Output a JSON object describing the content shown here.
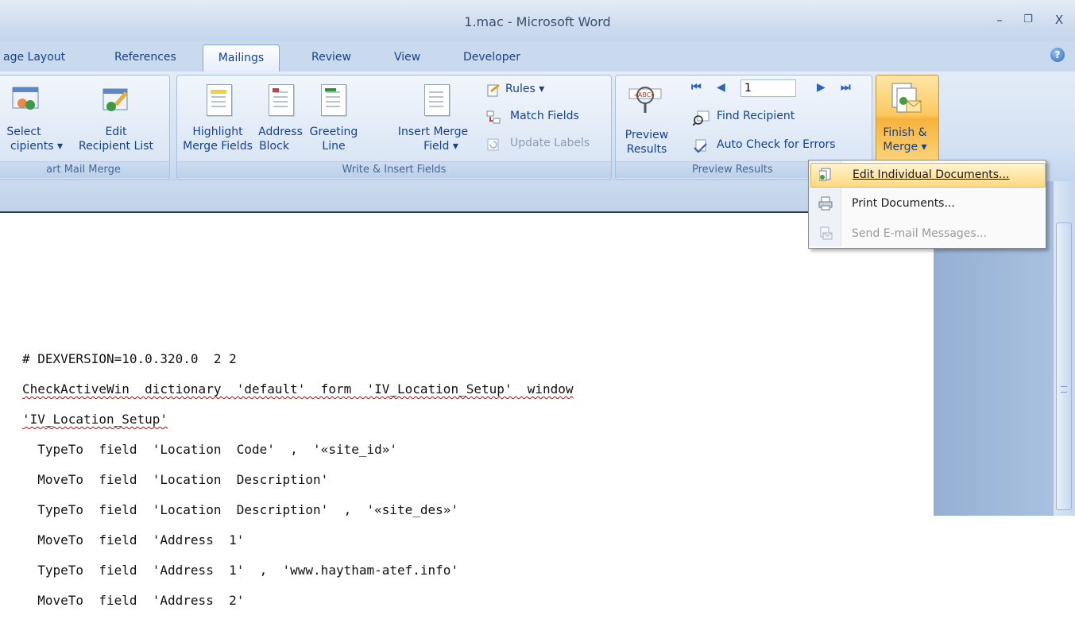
{
  "window": {
    "title": "1.mac - Microsoft Word",
    "minimize": "–",
    "restore": "❐",
    "close": "X"
  },
  "tabs": [
    {
      "label": "age Layout"
    },
    {
      "label": "References"
    },
    {
      "label": "Mailings"
    },
    {
      "label": "Review"
    },
    {
      "label": "View"
    },
    {
      "label": "Developer"
    }
  ],
  "active_tab": "Mailings",
  "help": "?",
  "ribbon": {
    "start": {
      "label": "art Mail Merge",
      "select_l1": "Select",
      "select_l2": "cipients ▾",
      "edit_l1": "Edit",
      "edit_l2": "Recipient List"
    },
    "write": {
      "label": "Write & Insert Fields",
      "highlight_l1": "Highlight",
      "highlight_l2": "Merge Fields",
      "address_l1": "Address",
      "address_l2": "Block",
      "greeting_l1": "Greeting",
      "greeting_l2": "Line",
      "insert_l1": "Insert Merge",
      "insert_l2": "Field ▾",
      "rules": "Rules ▾",
      "match": "Match Fields",
      "update": "Update Labels"
    },
    "preview": {
      "label": "Preview Results",
      "preview_l1": "Preview",
      "preview_l2": "Results",
      "record": "1",
      "find": "Find Recipient",
      "auto": "Auto Check for Errors"
    },
    "finish": {
      "l1": "Finish &",
      "l2": "Merge ▾"
    }
  },
  "menu": {
    "items": [
      {
        "label": "Edit Individual Documents...",
        "enabled": true,
        "highlighted": true
      },
      {
        "label": "Print Documents...",
        "enabled": true,
        "highlighted": false
      },
      {
        "label": "Send E-mail Messages...",
        "enabled": false,
        "highlighted": false
      }
    ]
  },
  "document": {
    "lines": [
      "# DEXVERSION=10.0.320.0  2 2",
      "CheckActiveWin  dictionary  'default'  form  'IV_Location_Setup'  window",
      "'IV_Location_Setup'",
      "  TypeTo  field  'Location  Code'  ,  '«site_id»'",
      "  MoveTo  field  'Location  Description'",
      "  TypeTo  field  'Location  Description'  ,  '«site_des»'",
      "  MoveTo  field  'Address  1'",
      "  TypeTo  field  'Address  1'  ,  'www.haytham-atef.info'",
      "  MoveTo  field  'Address  2'"
    ]
  },
  "colors": {
    "ribbon_bg": "#dae6f5",
    "text_blue": "#15428b",
    "menu_highlight": "#ffd97f"
  }
}
